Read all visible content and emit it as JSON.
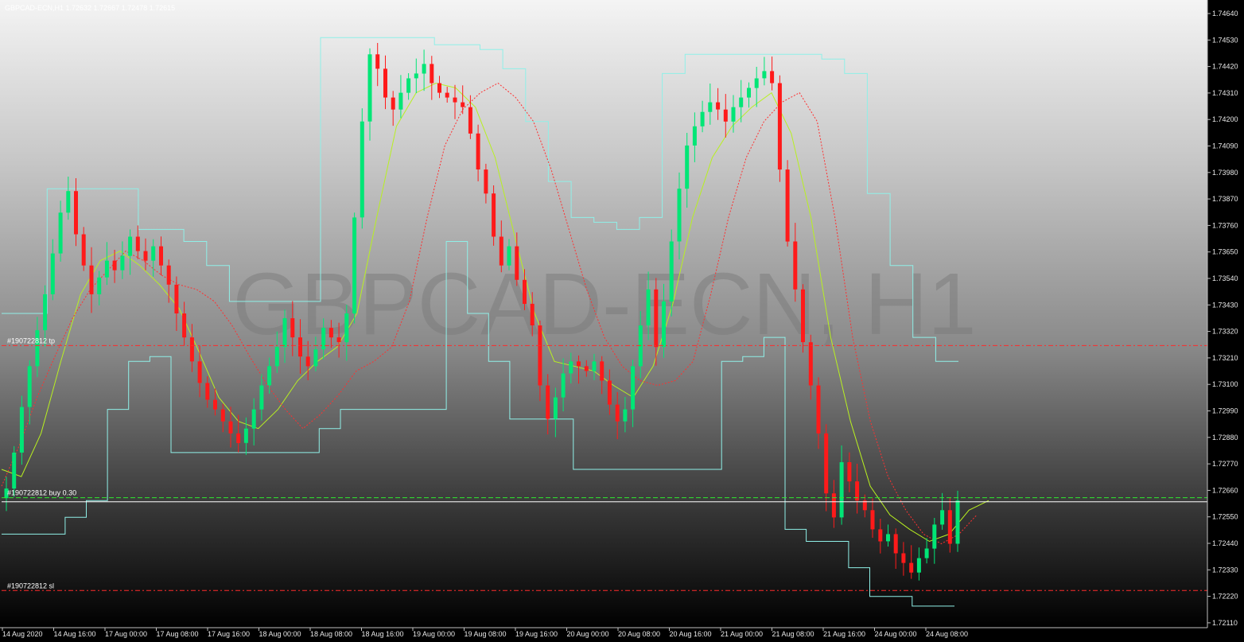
{
  "window": {
    "header_text": "GBPCAD-ECN,H1  1.72632 1.72667 1.72478 1.72615",
    "watermark": "GBPCAD-ECN, H1"
  },
  "colors": {
    "bull": "#00e676",
    "bear": "#ff1a1a",
    "envelope": "#8ff0e8",
    "ma_slow": "#b8f020",
    "ma_fast": "#ff3030",
    "grid_line": "#ff2b2b",
    "entry_line": "#2eea2e",
    "bid_line": "#ffffff"
  },
  "levels": {
    "tp": {
      "price": 1.73266,
      "label": "#190722812 tp"
    },
    "entry": {
      "price": 1.72632,
      "label": "#190722812 buy 0.30"
    },
    "sl": {
      "price": 1.72245,
      "label": "#190722812 sl"
    },
    "bid": {
      "price": 1.72615,
      "label": "1.72615"
    }
  },
  "chart_data": {
    "type": "candlestick",
    "symbol": "GBPCAD-ECN",
    "timeframe": "H1",
    "ylim": [
      1.7211,
      1.7468
    ],
    "y_ticks": [
      "1.74640",
      "1.74530",
      "1.74420",
      "1.74310",
      "1.74200",
      "1.74090",
      "1.73980",
      "1.73870",
      "1.73760",
      "1.73650",
      "1.73540",
      "1.73430",
      "1.73320",
      "1.73210",
      "1.73100",
      "1.72990",
      "1.72880",
      "1.72770",
      "1.72660",
      "1.72550",
      "1.72440",
      "1.72330",
      "1.72220",
      "1.72110"
    ],
    "x_ticks": [
      "14 Aug 2020",
      "14 Aug 16:00",
      "17 Aug 00:00",
      "17 Aug 08:00",
      "17 Aug 16:00",
      "18 Aug 00:00",
      "18 Aug 08:00",
      "18 Aug 16:00",
      "19 Aug 00:00",
      "19 Aug 08:00",
      "19 Aug 16:00",
      "20 Aug 00:00",
      "20 Aug 08:00",
      "20 Aug 16:00",
      "21 Aug 00:00",
      "21 Aug 08:00",
      "21 Aug 16:00",
      "24 Aug 00:00",
      "24 Aug 08:00"
    ],
    "close_path": [
      1.7267,
      1.7282,
      1.7301,
      1.7318,
      1.7333,
      1.7348,
      1.7365,
      1.7382,
      1.7391,
      1.7373,
      1.736,
      1.7348,
      1.7355,
      1.7362,
      1.7358,
      1.7364,
      1.7372,
      1.7366,
      1.7362,
      1.7368,
      1.736,
      1.7352,
      1.734,
      1.733,
      1.732,
      1.7311,
      1.7304,
      1.73,
      1.7295,
      1.729,
      1.7286,
      1.7292,
      1.73,
      1.731,
      1.7318,
      1.7326,
      1.7338,
      1.733,
      1.7322,
      1.7318,
      1.7325,
      1.7334,
      1.733,
      1.7328,
      1.734,
      1.738,
      1.742,
      1.7448,
      1.7442,
      1.743,
      1.7425,
      1.7432,
      1.7438,
      1.744,
      1.7444,
      1.7436,
      1.7432,
      1.743,
      1.7428,
      1.7426,
      1.7415,
      1.74,
      1.739,
      1.7372,
      1.736,
      1.7368,
      1.7354,
      1.7344,
      1.7335,
      1.731,
      1.7296,
      1.7305,
      1.7315,
      1.732,
      1.7318,
      1.7316,
      1.732,
      1.7312,
      1.7302,
      1.7295,
      1.73,
      1.7318,
      1.7335,
      1.735,
      1.7326,
      1.7345,
      1.737,
      1.7392,
      1.741,
      1.7418,
      1.7424,
      1.7428,
      1.7425,
      1.742,
      1.7426,
      1.743,
      1.7434,
      1.7438,
      1.7441,
      1.7436,
      1.74,
      1.737,
      1.735,
      1.7328,
      1.731,
      1.729,
      1.7265,
      1.7255,
      1.7278,
      1.727,
      1.7262,
      1.7258,
      1.725,
      1.7245,
      1.7248,
      1.724,
      1.7236,
      1.7232,
      1.7238,
      1.7242,
      1.7252,
      1.7258,
      1.7244,
      1.7262
    ],
    "fast_ma_path": [
      1.7268,
      1.7285,
      1.7305,
      1.7322,
      1.7338,
      1.735,
      1.7358,
      1.7366,
      1.7362,
      1.7356,
      1.7352,
      1.735,
      1.7345,
      1.7335,
      1.7322,
      1.731,
      1.73,
      1.7292,
      1.7298,
      1.7306,
      1.7316,
      1.732,
      1.7326,
      1.7345,
      1.738,
      1.741,
      1.7425,
      1.7432,
      1.7436,
      1.743,
      1.742,
      1.74,
      1.7375,
      1.735,
      1.733,
      1.7318,
      1.7312,
      1.731,
      1.7312,
      1.732,
      1.7348,
      1.738,
      1.7405,
      1.742,
      1.7428,
      1.7432,
      1.742,
      1.738,
      1.733,
      1.7295,
      1.7272,
      1.7258,
      1.7248,
      1.7244,
      1.7248,
      1.7256
    ],
    "slow_ma_path": [
      1.7275,
      1.7272,
      1.729,
      1.732,
      1.7348,
      1.7362,
      1.7366,
      1.736,
      1.7352,
      1.7342,
      1.7324,
      1.7305,
      1.7295,
      1.7292,
      1.73,
      1.7312,
      1.732,
      1.7326,
      1.734,
      1.738,
      1.7418,
      1.7432,
      1.7436,
      1.7434,
      1.7426,
      1.7405,
      1.7372,
      1.734,
      1.732,
      1.7318,
      1.7316,
      1.731,
      1.7305,
      1.7318,
      1.7344,
      1.738,
      1.7405,
      1.7418,
      1.7426,
      1.7432,
      1.7415,
      1.738,
      1.733,
      1.7295,
      1.7268,
      1.7256,
      1.725,
      1.7245,
      1.7248,
      1.7258,
      1.7262
    ],
    "upper_envelope_steps": [
      1.734,
      1.734,
      1.7392,
      1.7392,
      1.7392,
      1.7392,
      1.7375,
      1.7375,
      1.737,
      1.736,
      1.7345,
      1.7345,
      1.7345,
      1.7345,
      1.7455,
      1.7455,
      1.7455,
      1.7455,
      1.7455,
      1.7452,
      1.7452,
      1.745,
      1.7442,
      1.742,
      1.7395,
      1.738,
      1.7378,
      1.7375,
      1.738,
      1.744,
      1.7448,
      1.7448,
      1.7448,
      1.7448,
      1.7448,
      1.7448,
      1.7446,
      1.744,
      1.739,
      1.736,
      1.733,
      1.732
    ],
    "lower_envelope_steps": [
      1.7248,
      1.7248,
      1.7248,
      1.7255,
      1.7262,
      1.73,
      1.732,
      1.7322,
      1.7282,
      1.7282,
      1.7282,
      1.7282,
      1.7282,
      1.7282,
      1.7282,
      1.7292,
      1.73,
      1.73,
      1.73,
      1.73,
      1.73,
      1.737,
      1.734,
      1.732,
      1.7296,
      1.7296,
      1.7296,
      1.7275,
      1.7275,
      1.7275,
      1.7275,
      1.7275,
      1.7275,
      1.7275,
      1.732,
      1.7322,
      1.733,
      1.725,
      1.7245,
      1.7245,
      1.7234,
      1.7222,
      1.7222,
      1.7218,
      1.7218
    ]
  }
}
